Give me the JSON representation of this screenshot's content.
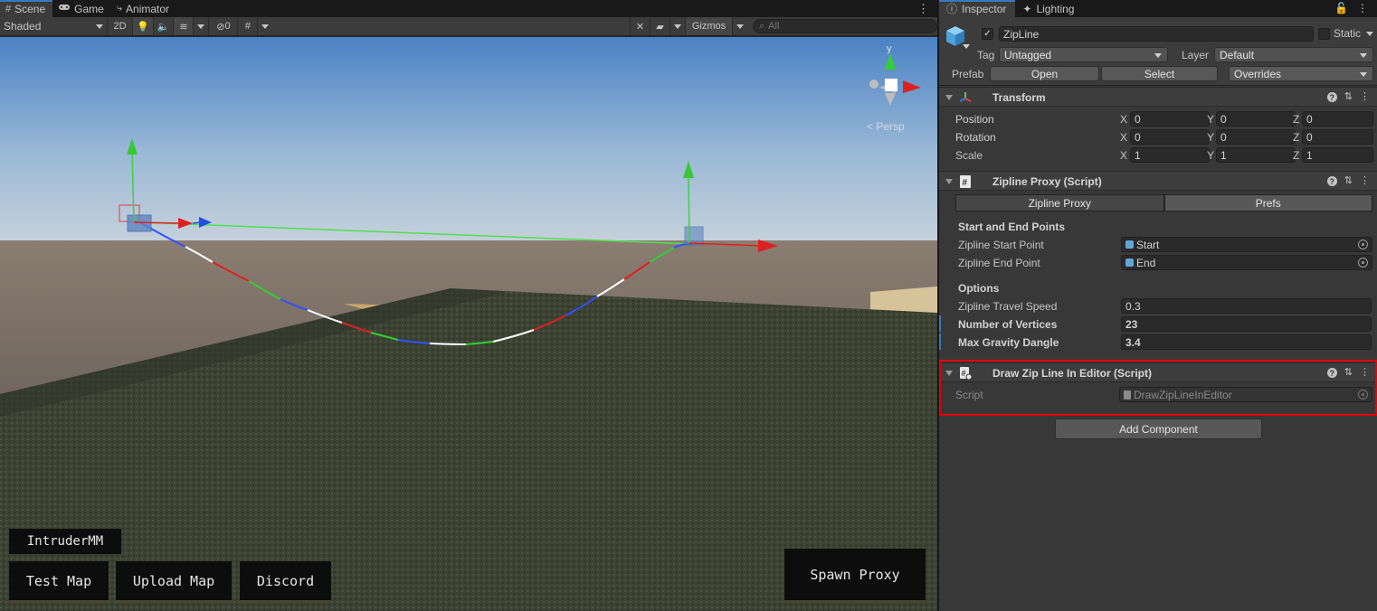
{
  "scene": {
    "tabs": [
      {
        "icon": "scene-grid-icon",
        "label": "Scene"
      },
      {
        "icon": "gamepad-icon",
        "label": "Game"
      },
      {
        "icon": "animator-icon",
        "label": "Animator"
      }
    ],
    "toolbar": {
      "shading_mode": "Shaded",
      "mode_2d": "2D",
      "hidden_count": "0",
      "gizmos": "Gizmos",
      "search_placeholder": "All"
    },
    "overlay_buttons": {
      "intruder": "IntruderMM",
      "test_map": "Test Map",
      "upload_map": "Upload Map",
      "discord": "Discord",
      "spawn_proxy": "Spawn Proxy"
    },
    "orientation_label": "< Persp",
    "axis_y": "y"
  },
  "inspector": {
    "tabs": [
      {
        "icon": "info-icon",
        "label": "Inspector"
      },
      {
        "icon": "lighting-icon",
        "label": "Lighting"
      }
    ],
    "object": {
      "name": "ZipLine",
      "static_label": "Static",
      "tag_label": "Tag",
      "tag_value": "Untagged",
      "layer_label": "Layer",
      "layer_value": "Default",
      "prefab_label": "Prefab",
      "open": "Open",
      "select": "Select",
      "overrides": "Overrides"
    },
    "transform": {
      "title": "Transform",
      "rows": [
        {
          "label": "Position",
          "x": "0",
          "y": "0",
          "z": "0"
        },
        {
          "label": "Rotation",
          "x": "0",
          "y": "0",
          "z": "0"
        },
        {
          "label": "Scale",
          "x": "1",
          "y": "1",
          "z": "1"
        }
      ],
      "axes": [
        "X",
        "Y",
        "Z"
      ]
    },
    "zipline_proxy": {
      "title": "Zipline Proxy (Script)",
      "tab_main": "Zipline Proxy",
      "tab_prefs": "Prefs",
      "section_points": "Start and End Points",
      "start_label": "Zipline Start Point",
      "start_value": "Start",
      "end_label": "Zipline End Point",
      "end_value": "End",
      "section_options": "Options",
      "speed_label": "Zipline Travel Speed",
      "speed_value": "0.3",
      "vertices_label": "Number of Vertices",
      "vertices_value": "23",
      "dangle_label": "Max Gravity Dangle",
      "dangle_value": "3.4"
    },
    "draw_zipline": {
      "title": "Draw Zip Line In Editor (Script)",
      "script_label": "Script",
      "script_value": "DrawZipLineInEditor"
    },
    "add_component": "Add Component"
  },
  "colors": {
    "accent": "#3a79bb",
    "highlight": "#e60000",
    "axis_x": "#e02020",
    "axis_y": "#20e020",
    "axis_z": "#2050e0"
  }
}
